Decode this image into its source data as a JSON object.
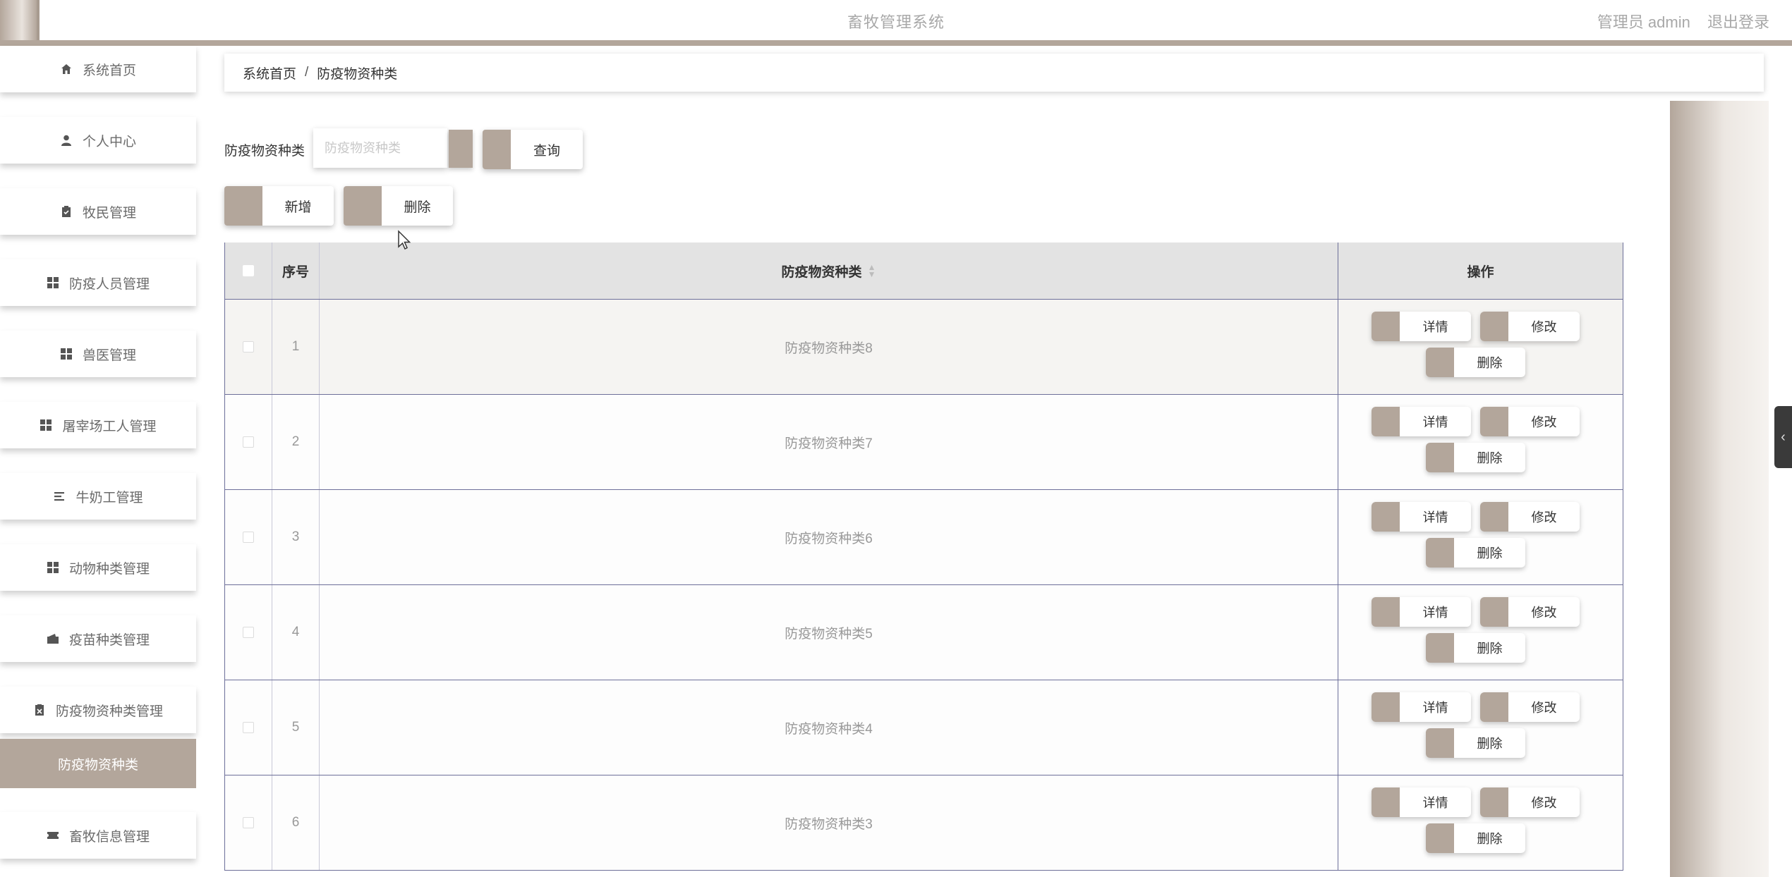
{
  "header": {
    "title": "畜牧管理系统",
    "user_label": "管理员 admin",
    "logout_label": "退出登录"
  },
  "sidebar": {
    "items": [
      {
        "label": "系统首页",
        "icon": "home-icon"
      },
      {
        "label": "个人中心",
        "icon": "user-icon"
      },
      {
        "label": "牧民管理",
        "icon": "clipboard-icon"
      },
      {
        "label": "防疫人员管理",
        "icon": "grid-icon"
      },
      {
        "label": "兽医管理",
        "icon": "grid-icon"
      },
      {
        "label": "屠宰场工人管理",
        "icon": "grid-icon"
      },
      {
        "label": "牛奶工管理",
        "icon": "list-icon"
      },
      {
        "label": "动物种类管理",
        "icon": "grid-icon"
      },
      {
        "label": "疫苗种类管理",
        "icon": "wallet-icon"
      },
      {
        "label": "防疫物资种类管理",
        "icon": "document-icon"
      },
      {
        "label": "防疫物资种类",
        "icon": ""
      },
      {
        "label": "畜牧信息管理",
        "icon": "ticket-icon"
      }
    ],
    "active_index": 10
  },
  "breadcrumb": {
    "home": "系统首页",
    "separator": "/",
    "current": "防疫物资种类"
  },
  "search": {
    "label": "防疫物资种类",
    "placeholder": "防疫物资种类",
    "value": "",
    "query_button": "查询"
  },
  "actions": {
    "add_button": "新增",
    "delete_button": "删除"
  },
  "table": {
    "headers": {
      "index": "序号",
      "name": "防疫物资种类",
      "ops": "操作"
    },
    "rows": [
      {
        "index": "1",
        "name": "防疫物资种类8"
      },
      {
        "index": "2",
        "name": "防疫物资种类7"
      },
      {
        "index": "3",
        "name": "防疫物资种类6"
      },
      {
        "index": "4",
        "name": "防疫物资种类5"
      },
      {
        "index": "5",
        "name": "防疫物资种类4"
      },
      {
        "index": "6",
        "name": "防疫物资种类3"
      }
    ],
    "row_actions": {
      "detail": "详情",
      "edit": "修改",
      "delete": "删除"
    }
  },
  "colors": {
    "accent": "#b3a69b",
    "table_border": "#6d6f99",
    "header_bg": "#e3e3e3"
  }
}
